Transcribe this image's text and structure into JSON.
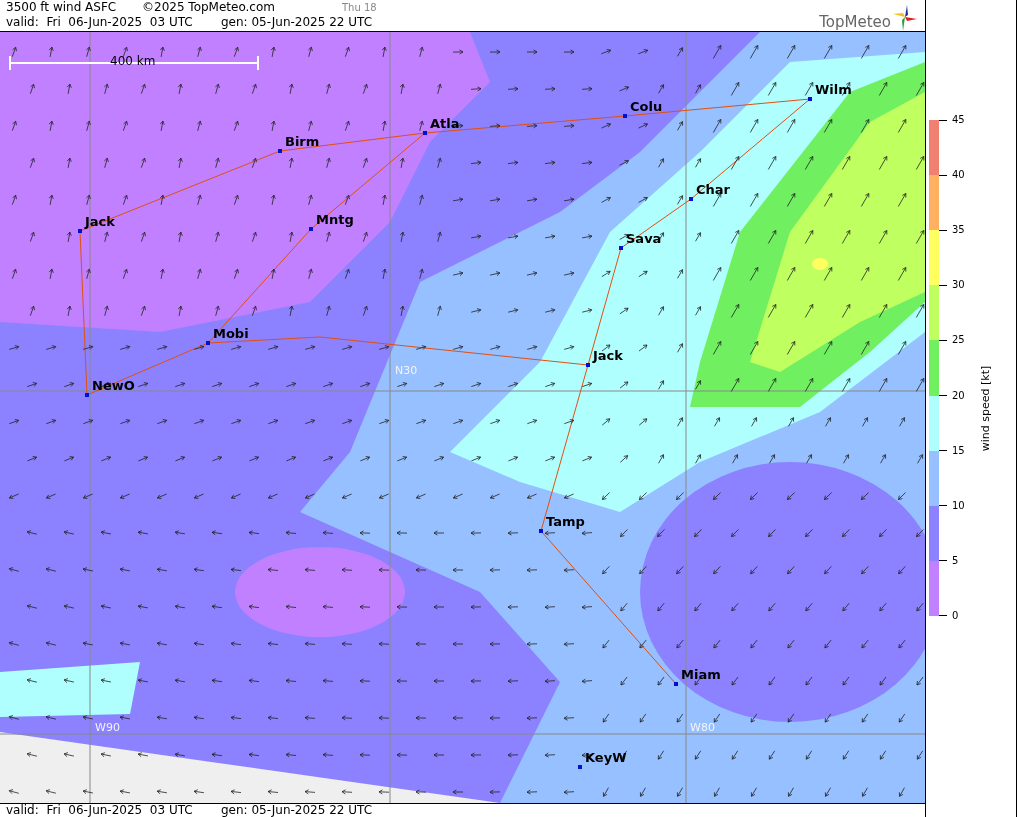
{
  "header": {
    "title": "3500 ft wind ASFC",
    "copyright": "©2025 TopMeteo.com",
    "day_label": "Thu 18",
    "valid": "valid:  Fri  06-Jun-2025  03 UTC",
    "generated": "gen: 05-Jun-2025 22 UTC",
    "logo": "TopMeteo"
  },
  "map": {
    "scale": "400 km",
    "grid_labels": [
      "N30",
      "W90",
      "W80"
    ],
    "cities": [
      "Birm",
      "Atla",
      "Colu",
      "Wilm",
      "Char",
      "Sava",
      "Jack",
      "Mntg",
      "Mobi",
      "NewO",
      "Jack",
      "Tamp",
      "Miam",
      "KeyW"
    ]
  },
  "legend": {
    "title": "wind speed [kt]",
    "ticks": [
      "45",
      "40",
      "35",
      "30",
      "25",
      "20",
      "15",
      "10",
      "5",
      "0"
    ],
    "bands": [
      {
        "color": "#f08070"
      },
      {
        "color": "#ffb060"
      },
      {
        "color": "#ffff60"
      },
      {
        "color": "#c0ff60"
      },
      {
        "color": "#70f060"
      },
      {
        "color": "#b0ffff"
      },
      {
        "color": "#96c0ff"
      },
      {
        "color": "#8c82ff"
      },
      {
        "color": "#c080ff"
      }
    ]
  },
  "footer": {
    "valid": "valid:  Fri  06-Jun-2025  03 UTC",
    "generated": "gen: 05-Jun-2025 22 UTC"
  }
}
